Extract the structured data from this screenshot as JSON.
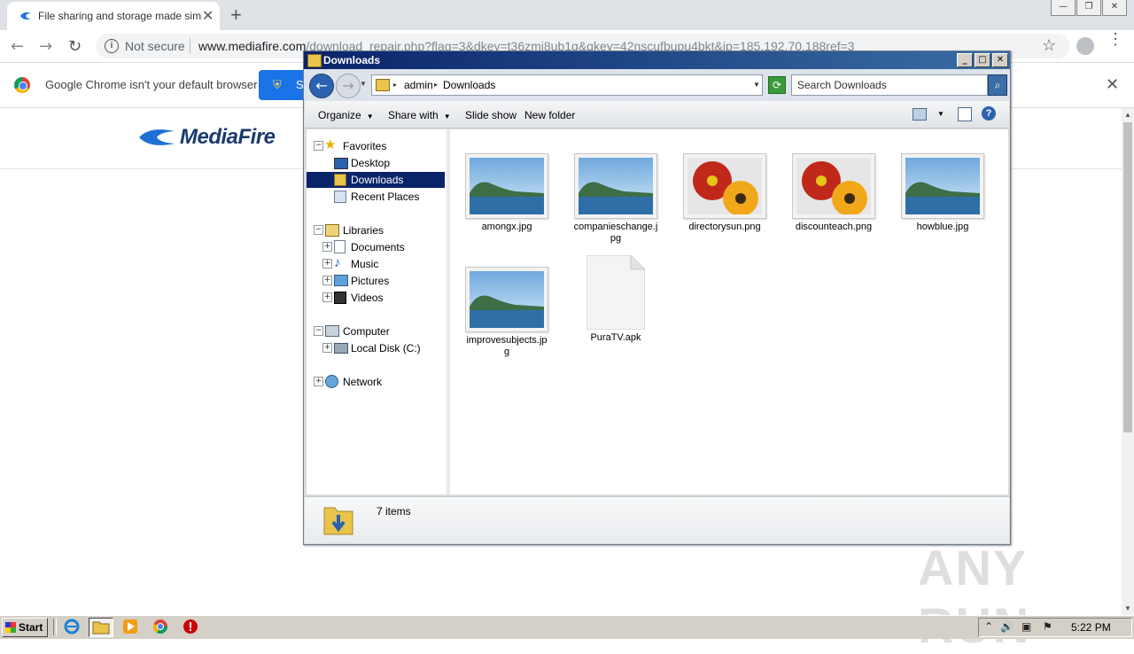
{
  "chrome": {
    "tab": {
      "title": "File sharing and storage made simple",
      "close": "✕"
    },
    "new_tab": "+",
    "window_controls": [
      "—",
      "❐",
      "✕"
    ],
    "nav": {
      "back": "←",
      "forward": "→",
      "reload": "↻"
    },
    "omnibox": {
      "info": "i",
      "security_label": "Not secure",
      "host": "www.mediafire.com",
      "path": "/download_repair.php?flag=3&dkey=t36zmi8ub1q&qkey=42nscufbupu4bkt&ip=185.192.70.188ref=3"
    },
    "bookmark": "☆",
    "menu": "⋮",
    "infobar": {
      "text": "Google Chrome isn't your default browser",
      "button": "S",
      "close": "✕"
    }
  },
  "page": {
    "logo_text": "MediaFire",
    "watermark": "ANY RUN",
    "scroll_up": "▲",
    "scroll_down": "▼"
  },
  "explorer": {
    "title": "Downloads",
    "controls": [
      "_",
      "□",
      "✕"
    ],
    "back": "←",
    "forward": "→",
    "history_arrow": "▼",
    "breadcrumb": [
      "admin",
      "Downloads"
    ],
    "crumb_arrow": "▸",
    "addr_drop": "▼",
    "refresh": "⟳",
    "search_placeholder": "Search Downloads",
    "search_icon": "⌕",
    "commands": {
      "organize": "Organize",
      "share_with": "Share with",
      "slide_show": "Slide show",
      "new_folder": "New folder"
    },
    "cmd_arrow": "▼",
    "help": "?",
    "nav_tree": {
      "favorites": "Favorites",
      "desktop": "Desktop",
      "downloads": "Downloads",
      "recent": "Recent Places",
      "libraries": "Libraries",
      "documents": "Documents",
      "music": "Music",
      "pictures": "Pictures",
      "videos": "Videos",
      "computer": "Computer",
      "local_disk": "Local Disk (C:)",
      "network": "Network"
    },
    "expanders": {
      "minus": "−",
      "plus": "+"
    },
    "files": [
      {
        "name": "amongx.jpg",
        "kind": "landscape"
      },
      {
        "name": "companieschange.jpg",
        "kind": "landscape"
      },
      {
        "name": "directorysun.png",
        "kind": "flowers"
      },
      {
        "name": "discounteach.png",
        "kind": "flowers"
      },
      {
        "name": "howblue.jpg",
        "kind": "landscape"
      },
      {
        "name": "improvesubjects.jpg",
        "kind": "landscape"
      },
      {
        "name": "PuraTV.apk",
        "kind": "generic"
      }
    ],
    "status": "7 items"
  },
  "taskbar": {
    "start": "Start",
    "tray_icons": [
      "⌃",
      "🔊",
      "▣",
      "⚑"
    ],
    "clock": "5:22 PM"
  }
}
